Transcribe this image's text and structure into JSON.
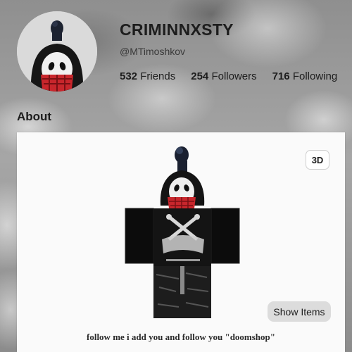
{
  "profile": {
    "display_name": "CRIMINNXSTY",
    "username": "@MTimoshkov",
    "stats": [
      {
        "count": "532",
        "label": "Friends"
      },
      {
        "count": "254",
        "label": "Followers"
      },
      {
        "count": "716",
        "label": "Following"
      }
    ]
  },
  "about": {
    "title": "About",
    "description": "follow me i add you and follow you \"doomshop\""
  },
  "avatar_viewer": {
    "view_3d_label": "3D",
    "show_items_label": "Show Items"
  }
}
